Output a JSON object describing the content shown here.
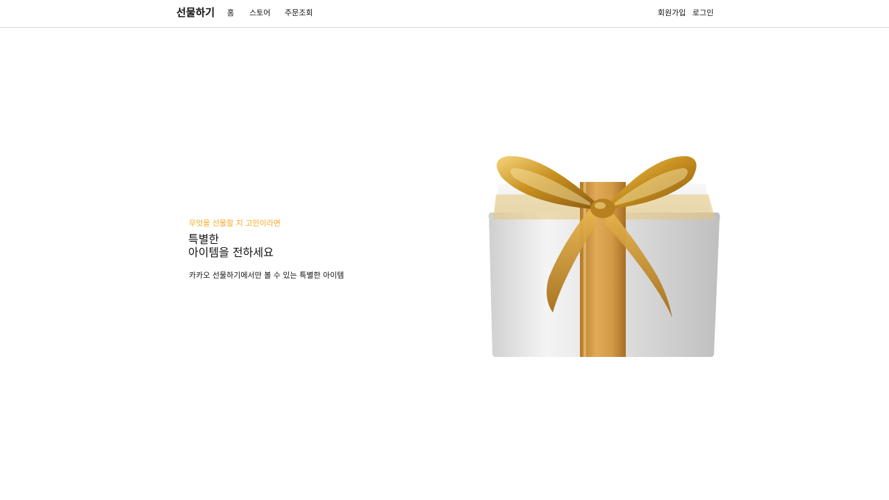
{
  "header": {
    "brand": "선물하기",
    "nav": {
      "home": "홈",
      "store": "스토어",
      "orders": "주문조회"
    },
    "auth": {
      "signup": "회원가입",
      "login": "로그인"
    }
  },
  "hero": {
    "eyebrow": "무엇을 선물할 지 고민이라면",
    "title_line1": "특별한",
    "title_line2": "아이템을 전하세요",
    "subtitle": "카카오 선물하기에서만 볼 수 있는 특별한 아이템",
    "image_icon": "gift-box-icon"
  },
  "colors": {
    "accent": "#f5a623",
    "ribbon_gold": "#d4a24a",
    "box_silver": "#e4e4e4",
    "divider": "#d9d9d9"
  }
}
